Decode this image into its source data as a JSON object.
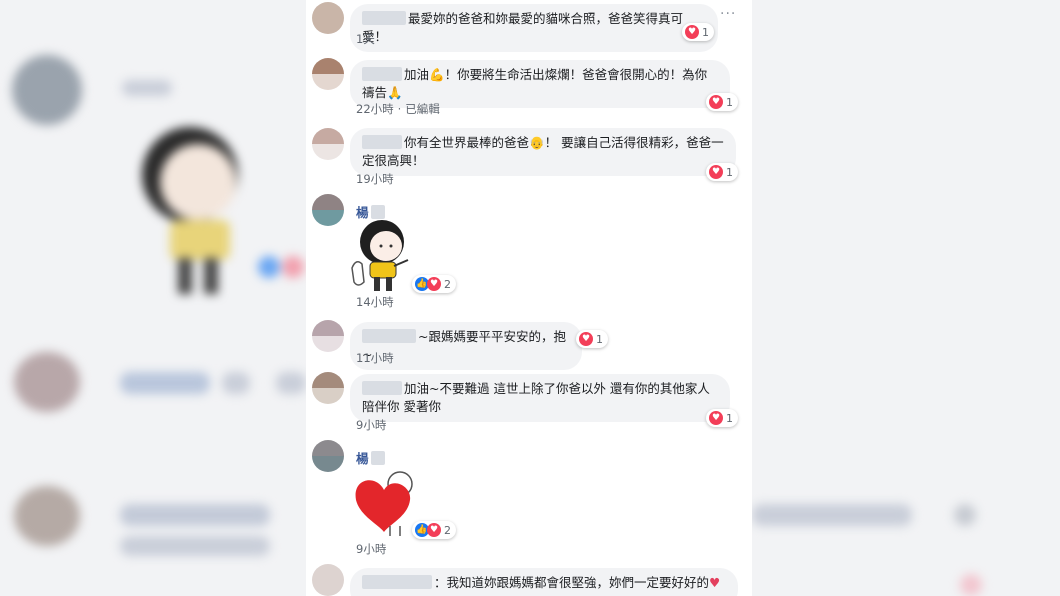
{
  "comments": [
    {
      "text": "最愛妳的爸爸和妳最愛的貓咪合照，爸爸笑得真可愛！",
      "time": "1天",
      "reaction_count": "1",
      "reaction": "heart-icon"
    },
    {
      "text_prefix": "加油",
      "text_suffix": "！你要將生命活出燦爛！爸爸會很開心的！為你禱告",
      "time": "22小時",
      "edited": "已編輯",
      "reaction_count": "1",
      "reaction": "heart-icon"
    },
    {
      "text_prefix": "你有全世界最棒的爸爸",
      "text_suffix": "！ 要讓自己活得很精彩，爸爸一定很高興！",
      "time": "19小時",
      "reaction_count": "1",
      "reaction": "heart-icon"
    },
    {
      "name": "楊",
      "time": "14小時",
      "reaction_count": "2",
      "reaction": "like-heart-icons"
    },
    {
      "text": "~跟媽媽要平平安安的，抱~",
      "time": "11小時",
      "reaction_count": "1",
      "reaction": "heart-icon"
    },
    {
      "text": "加油~不要難過 這世上除了你爸以外 還有你的其他家人 陪伴你 愛著你",
      "time": "9小時",
      "reaction_count": "1",
      "reaction": "heart-icon"
    },
    {
      "name": "楊",
      "time": "9小時",
      "reaction_count": "2",
      "reaction": "like-heart-icons"
    },
    {
      "text": "：我知道妳跟媽媽都會很堅強，妳們一定要好好的"
    }
  ],
  "more_menu": "···",
  "colors": {
    "link": "#385898",
    "heart": "#f33e58",
    "like": "#1877f2",
    "bubble": "#f2f3f5"
  }
}
